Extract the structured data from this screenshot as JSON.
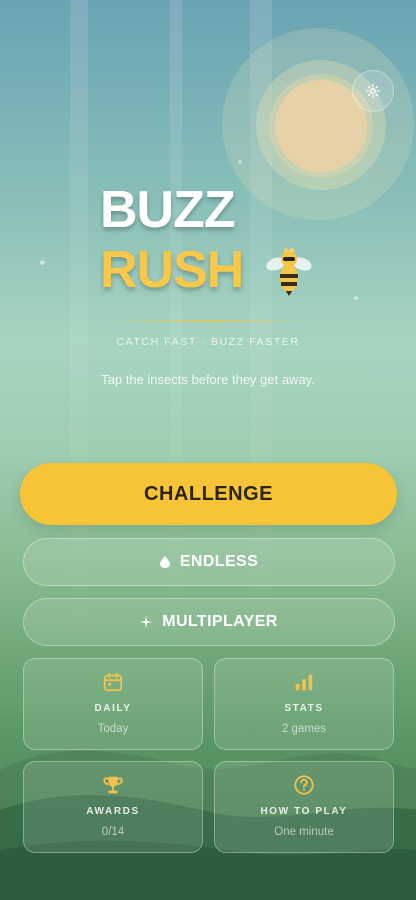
{
  "title": {
    "line1": "BUZZ",
    "line2": "RUSH"
  },
  "tagline": "CATCH FAST · BUZZ FASTER",
  "instruction": "Tap the insects before they get away.",
  "buttons": {
    "challenge": "CHALLENGE",
    "endless": "ENDLESS",
    "multiplayer": "MULTIPLAYER"
  },
  "tiles": {
    "daily": {
      "title": "DAILY",
      "subtitle": "Today",
      "icon": "calendar-icon"
    },
    "stats": {
      "title": "STATS",
      "subtitle": "2 games",
      "icon": "bar-chart-icon"
    },
    "awards": {
      "title": "AWARDS",
      "subtitle": "0/14",
      "icon": "trophy-icon"
    },
    "how_to_play": {
      "title": "HOW TO PLAY",
      "subtitle": "One minute",
      "icon": "question-icon"
    }
  },
  "colors": {
    "accent": "#f7c337",
    "logo_yellow": "#f7c84a",
    "icon_gold": "#f2c14e"
  }
}
